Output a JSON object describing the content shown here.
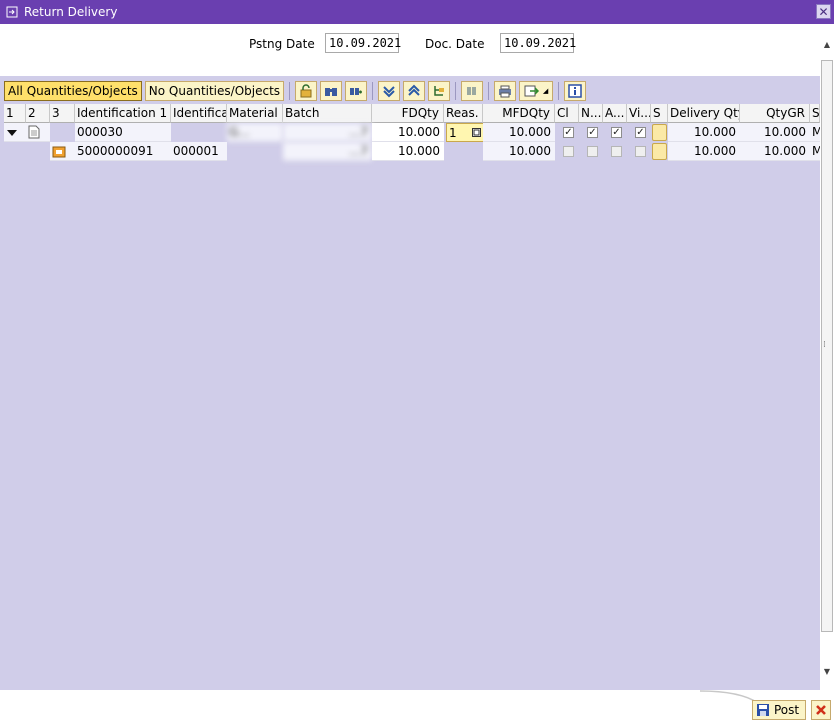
{
  "window": {
    "title": "Return Delivery",
    "close_label": "✕"
  },
  "dates": {
    "posting_label": "Pstng Date",
    "posting_value": "10.09.2021",
    "doc_label": "Doc. Date",
    "doc_value": "10.09.2021"
  },
  "toolbar": {
    "all_quantities": "All Quantities/Objects",
    "no_quantities": "No Quantities/Objects"
  },
  "grid": {
    "headers": {
      "c1": "1",
      "c2": "2",
      "c3": "3",
      "id1": "Identification 1",
      "id2": "Identifica",
      "material": "Material",
      "batch": "Batch",
      "fdqty": "FDQty",
      "reas": "Reas.",
      "mfdqty": "MFDQty",
      "cl": "Cl",
      "n": "N...",
      "a": "A...",
      "vi": "Vi...",
      "s": "S",
      "delivery_qty": "Delivery Qty",
      "qtygr": "QtyGR",
      "s2": "S"
    },
    "row1": {
      "identification1": "000030",
      "material": "G...",
      "batch": "...7",
      "fdqty": "10.000",
      "reason": "1",
      "mfdqty": "10.000",
      "delivery_qty": "10.000",
      "qtygr": "10.000",
      "s2": "M"
    },
    "row2": {
      "identification1": "5000000091",
      "identification2": "000001",
      "batch": "...7",
      "fdqty": "10.000",
      "mfdqty": "10.000",
      "delivery_qty": "10.000",
      "qtygr": "10.000",
      "s2": "M"
    }
  },
  "footer": {
    "post_label": "Post"
  }
}
